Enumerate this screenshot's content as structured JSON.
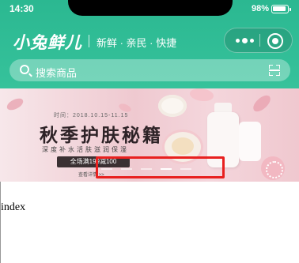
{
  "status_bar": {
    "time": "14:30",
    "battery": "98%"
  },
  "header": {
    "brand": "小兔鲜儿",
    "slogan": "新鲜 · 亲民 · 快捷",
    "search_placeholder": "搜索商品"
  },
  "banner": {
    "date": "时间：2018.10.15-11.15",
    "title": "秋季护肤秘籍",
    "subtitle": "深度补水活肤滋润保湿",
    "promo": "全场满199减100",
    "more": "查看详情 >>",
    "dots_count": 5,
    "active_dot_index": 3
  },
  "page": {
    "label": "index"
  },
  "colors": {
    "header_green": "#2bb891",
    "highlight_red": "#e8201f"
  }
}
